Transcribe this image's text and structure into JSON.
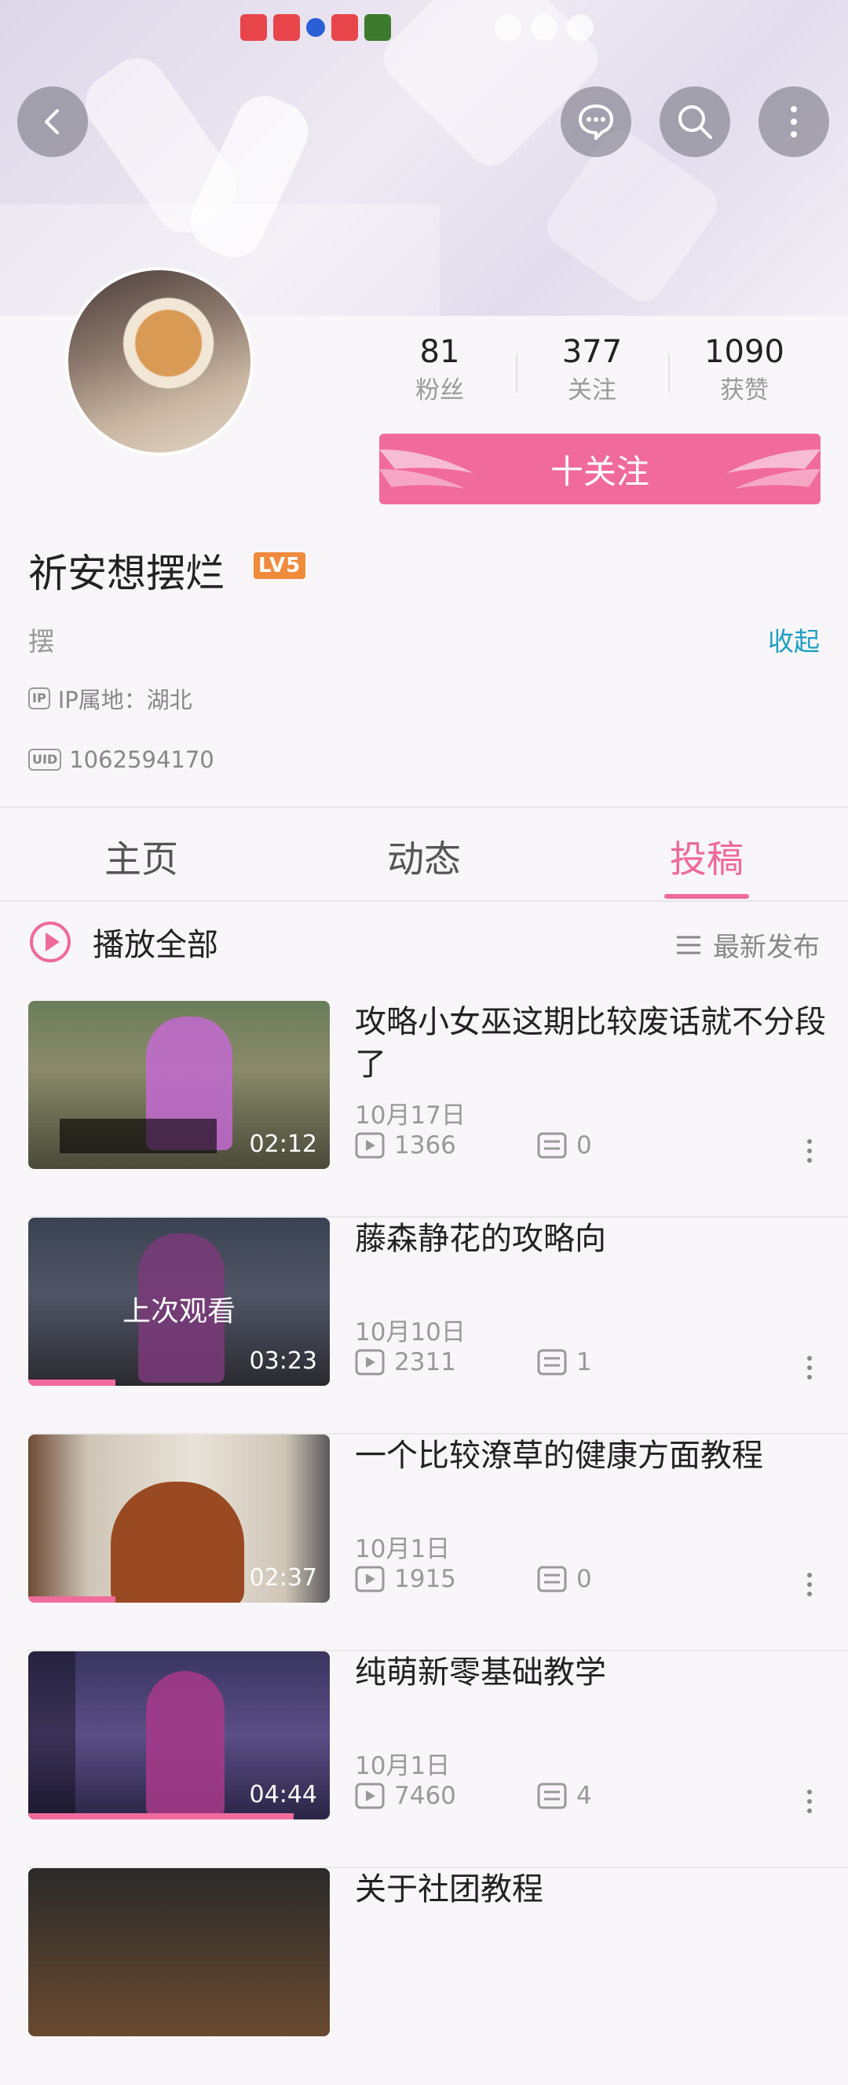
{
  "profile": {
    "username": "祈安想摆烂",
    "level": "LV5",
    "bio": "摆",
    "collapse_label": "收起",
    "ip_label": "IP属地：湖北",
    "ip_icon": "IP",
    "uid": "1062594170",
    "uid_icon": "UID"
  },
  "stats": [
    {
      "value": "81",
      "label": "粉丝"
    },
    {
      "value": "377",
      "label": "关注"
    },
    {
      "value": "1090",
      "label": "获赞"
    }
  ],
  "follow_button": "十关注",
  "tabs": [
    {
      "label": "主页"
    },
    {
      "label": "动态"
    },
    {
      "label": "投稿"
    }
  ],
  "active_tab": "投稿",
  "play_all": "播放全部",
  "sort_label": "最新发布",
  "videos": [
    {
      "title": "攻略小女巫这期比较废话就不分段了",
      "date": "10月17日",
      "views": "1366",
      "comments": "0",
      "duration": "02:12",
      "progress": 0,
      "last_watched": ""
    },
    {
      "title": "藤森静花的攻略向",
      "date": "10月10日",
      "views": "2311",
      "comments": "1",
      "duration": "03:23",
      "progress": 0.29,
      "last_watched": "上次观看"
    },
    {
      "title": "一个比较潦草的健康方面教程",
      "date": "10月1日",
      "views": "1915",
      "comments": "0",
      "duration": "02:37",
      "progress": 0.29,
      "last_watched": ""
    },
    {
      "title": "纯萌新零基础教学",
      "date": "10月1日",
      "views": "7460",
      "comments": "4",
      "duration": "04:44",
      "progress": 0.88,
      "last_watched": ""
    },
    {
      "title": "关于社团教程",
      "date": "",
      "views": "",
      "comments": "",
      "duration": "",
      "progress": 0,
      "last_watched": ""
    }
  ],
  "colors": {
    "accent_pink": "#f06b9b",
    "link_blue": "#1e9ec2",
    "level_orange": "#f08a3c"
  }
}
